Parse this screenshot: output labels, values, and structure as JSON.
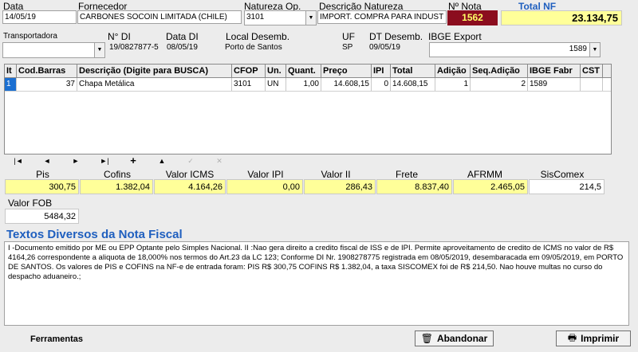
{
  "header": {
    "data_label": "Data",
    "data_value": "14/05/19",
    "fornecedor_label": "Fornecedor",
    "fornecedor_value": "CARBONES SOCOIN LIMITADA (CHILE)",
    "natureza_op_label": "Natureza Op.",
    "natureza_op_value": "3101",
    "descricao_natureza_label": "Descrição Natureza",
    "descricao_natureza_value": "IMPORT. COMPRA PARA INDUST",
    "nota_label": "Nº Nota",
    "nota_value": "1562",
    "total_nf_label": "Total NF",
    "total_nf_value": "23.134,75"
  },
  "transport": {
    "transportadora_label": "Transportadora",
    "transportadora_value": "",
    "di_label": "N° DI",
    "di_value": "19/0827877-5",
    "data_di_label": "Data DI",
    "data_di_value": "08/05/19",
    "local_desemb_label": "Local Desemb.",
    "local_desemb_value": "Porto de Santos",
    "uf_label": "UF",
    "uf_value": "SP",
    "dt_desemb_label": "DT Desemb.",
    "dt_desemb_value": "09/05/19",
    "ibge_label": "IBGE Export",
    "ibge_value": "1589"
  },
  "grid": {
    "columns": [
      "It",
      "Cod.Barras",
      "Descrição  (Digite para BUSCA)",
      "CFOP",
      "Un.",
      "Quant.",
      "Preço",
      "IPI",
      "Total",
      "Adição",
      "Seq.Adição",
      "IBGE Fabr",
      "CST"
    ],
    "rows": [
      [
        "1",
        "37",
        "Chapa Metálica",
        "3101",
        "UN",
        "1,00",
        "14.608,15",
        "0",
        "14.608,15",
        "1",
        "2",
        "1589",
        ""
      ]
    ]
  },
  "nav": {
    "first": "|◄",
    "prev": "◄",
    "next": "►",
    "last": "►|",
    "add": "+",
    "up": "▲",
    "check": "✓",
    "cancel": "✕"
  },
  "totals": {
    "pis_label": "Pis",
    "pis_value": "300,75",
    "cofins_label": "Cofins",
    "cofins_value": "1.382,04",
    "icms_label": "Valor ICMS",
    "icms_value": "4.164,26",
    "ipi_label": "Valor IPI",
    "ipi_value": "0,00",
    "ii_label": "Valor II",
    "ii_value": "286,43",
    "frete_label": "Frete",
    "frete_value": "8.837,40",
    "afrmm_label": "AFRMM",
    "afrmm_value": "2.465,05",
    "siscomex_label": "SisComex",
    "siscomex_value": "214,5",
    "fob_label": "Valor FOB",
    "fob_value": "5484,32"
  },
  "textos": {
    "title": "Textos Diversos da Nota Fiscal",
    "body": "I -Documento emitido por ME ou EPP Optante pelo Simples Nacional. II :Nao gera direito a credito fiscal de ISS e de IPI. Permite aproveitamento de credito de ICMS no valor de R$ 4164,26 correspondente a aliquota de 18,000% nos termos do Art.23 da LC 123; Conforme DI Nr. 1908278775 registrada em 08/05/2019, desembaracada em 09/05/2019, em PORTO DE SANTOS. Os valores de PIS e COFINS na NF-e de entrada foram: PIS R$ 300,75 COFINS R$ 1.382,04, a taxa SISCOMEX foi de R$ 214,50. Nao houve multas no curso do despacho aduaneiro.;"
  },
  "footer": {
    "ferramentas": "Ferramentas",
    "abandonar": "Abandonar",
    "imprimir": "Imprimir"
  },
  "colors": {
    "nota_bg": "#8b0d1e",
    "nota_text": "#ffff66",
    "total_nf_label": "#1f5fbf",
    "yellow_field": "#ffff99",
    "textos_title": "#1f5fbf"
  }
}
